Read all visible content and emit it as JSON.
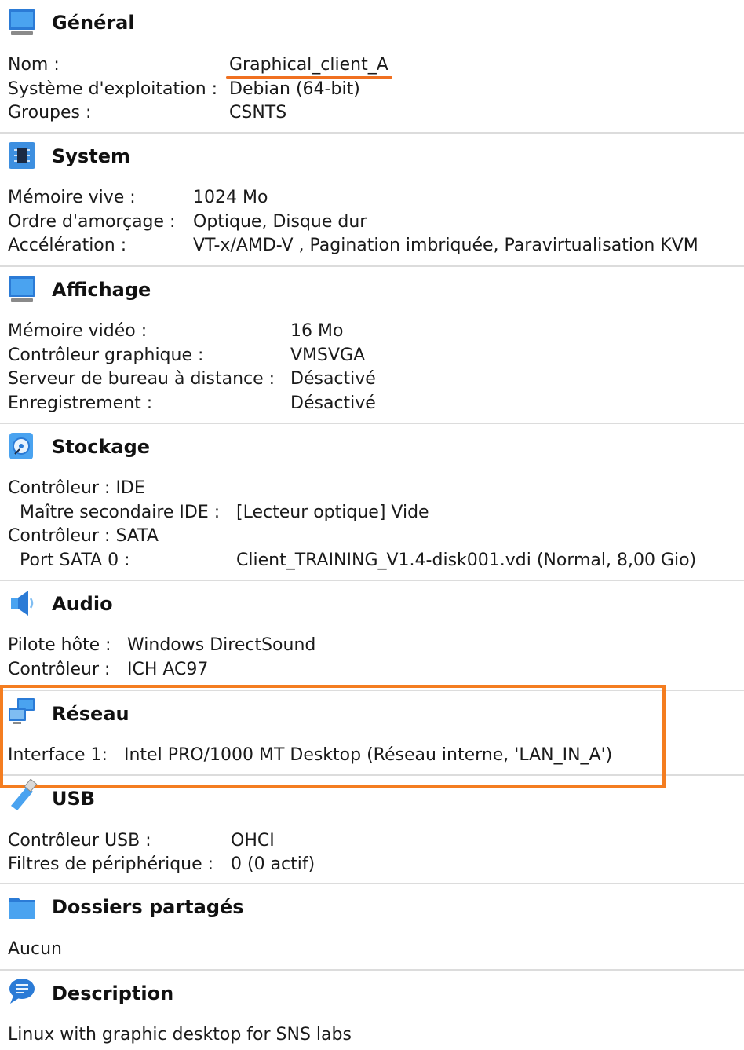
{
  "sections": {
    "general": {
      "title": "Général",
      "rows": [
        {
          "label": "Nom :",
          "value": "Graphical_client_A"
        },
        {
          "label": "Système d'exploitation :",
          "value": "Debian (64-bit)"
        },
        {
          "label": "Groupes :",
          "value": "CSNTS"
        }
      ]
    },
    "system": {
      "title": "System",
      "rows": [
        {
          "label": "Mémoire vive :",
          "value": "1024 Mo"
        },
        {
          "label": "Ordre d'amorçage :",
          "value": "Optique, Disque dur"
        },
        {
          "label": "Accélération :",
          "value": "VT-x/AMD-V , Pagination imbriquée, Paravirtualisation KVM"
        }
      ]
    },
    "display": {
      "title": "Affichage",
      "rows": [
        {
          "label": "Mémoire vidéo :",
          "value": "16 Mo"
        },
        {
          "label": "Contrôleur graphique :",
          "value": "VMSVGA"
        },
        {
          "label": "Serveur de bureau à distance :",
          "value": "Désactivé"
        },
        {
          "label": "Enregistrement :",
          "value": "Désactivé"
        }
      ]
    },
    "storage": {
      "title": "Stockage",
      "rows": [
        {
          "label": "Contrôleur : IDE",
          "value": ""
        },
        {
          "label": "Maître secondaire IDE :",
          "value": "[Lecteur optique] Vide"
        },
        {
          "label": "Contrôleur : SATA",
          "value": ""
        },
        {
          "label": "Port SATA 0 :",
          "value": "Client_TRAINING_V1.4-disk001.vdi (Normal, 8,00 Gio)"
        }
      ]
    },
    "audio": {
      "title": "Audio",
      "rows": [
        {
          "label": "Pilote hôte :",
          "value": "Windows DirectSound"
        },
        {
          "label": "Contrôleur :",
          "value": "ICH AC97"
        }
      ]
    },
    "network": {
      "title": "Réseau",
      "rows": [
        {
          "label": "Interface 1:",
          "value": "Intel PRO/1000 MT Desktop (Réseau interne, 'LAN_IN_A')"
        }
      ]
    },
    "usb": {
      "title": "USB",
      "rows": [
        {
          "label": "Contrôleur USB :",
          "value": "OHCI"
        },
        {
          "label": "Filtres de périphérique :",
          "value": "0 (0 actif)"
        }
      ]
    },
    "shared": {
      "title": "Dossiers partagés",
      "rows": [
        {
          "label": "Aucun",
          "value": ""
        }
      ]
    },
    "description": {
      "title": "Description",
      "rows": [
        {
          "label": "Linux with graphic desktop for SNS labs",
          "value": ""
        }
      ]
    }
  },
  "colors": {
    "accent_highlight": "#f47d20",
    "icon_blue": "#2b7bd6",
    "separator": "#dcdcdc"
  },
  "icons": {
    "general": "monitor-icon",
    "system": "chip-icon",
    "display": "monitor-icon",
    "storage": "disk-icon",
    "audio": "speaker-icon",
    "network": "network-icon",
    "usb": "usb-icon",
    "shared": "folder-icon",
    "description": "speech-bubble-icon"
  }
}
